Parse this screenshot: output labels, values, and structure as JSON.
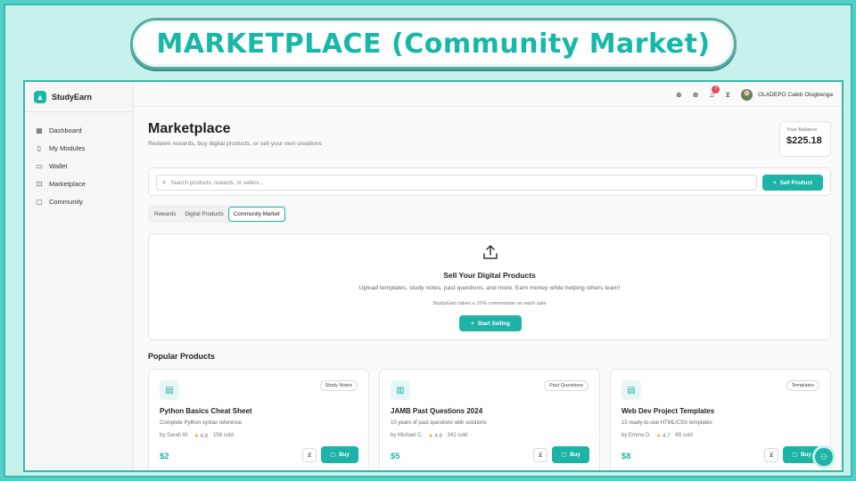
{
  "banner": {
    "title": "MARKETPLACE (Community Market)"
  },
  "brand": {
    "name": "StudyEarn",
    "logo_icon": "graduation-cap-icon"
  },
  "sidebar": {
    "items": [
      {
        "label": "Dashboard",
        "icon": "grid-icon"
      },
      {
        "label": "My Modules",
        "icon": "book-icon"
      },
      {
        "label": "Wallet",
        "icon": "wallet-icon"
      },
      {
        "label": "Marketplace",
        "icon": "store-icon"
      },
      {
        "label": "Community",
        "icon": "chat-icon"
      }
    ]
  },
  "topbar": {
    "notification_count": "7",
    "user_name": "OLADEPO Caleb Olugbenga"
  },
  "page": {
    "title": "Marketplace",
    "subtitle": "Redeem rewards, buy digital products, or sell your own creations"
  },
  "balance": {
    "label": "Your Balance",
    "value": "$225.18"
  },
  "search": {
    "placeholder": "Search products, rewards, or sellers...",
    "sell_button": "Sell Product"
  },
  "tabs": [
    {
      "label": "Rewards",
      "active": false
    },
    {
      "label": "Digital Products",
      "active": false
    },
    {
      "label": "Community Market",
      "active": true
    }
  ],
  "sell_card": {
    "title": "Sell Your Digital Products",
    "description": "Upload templates, study notes, past questions, and more. Earn money while helping others learn!",
    "commission": "StudyEarn takes a 10% commission on each sale",
    "button": "Start Selling"
  },
  "popular": {
    "title": "Popular Products",
    "products": [
      {
        "tag": "Study Notes",
        "icon": "document-icon",
        "name": "Python Basics Cheat Sheet",
        "description": "Complete Python syntax reference",
        "author": "by Sarah W.",
        "rating": "4.8",
        "sold": "156 sold",
        "price": "$2",
        "buy_label": "Buy"
      },
      {
        "tag": "Past Questions",
        "icon": "open-book-icon",
        "name": "JAMB Past Questions 2024",
        "description": "10 years of past questions with solutions",
        "author": "by Michael C.",
        "rating": "4.9",
        "sold": "342 sold",
        "price": "$5",
        "buy_label": "Buy"
      },
      {
        "tag": "Templates",
        "icon": "document-icon",
        "name": "Web Dev Project Templates",
        "description": "15 ready-to-use HTML/CSS templates",
        "author": "by Emma D.",
        "rating": "4.7",
        "sold": "89 sold",
        "price": "$8",
        "buy_label": "Buy"
      }
    ]
  },
  "colors": {
    "accent": "#1eb3a6",
    "frame": "#4fd1c5",
    "star": "#f59e0b",
    "badge": "#e5484d"
  }
}
